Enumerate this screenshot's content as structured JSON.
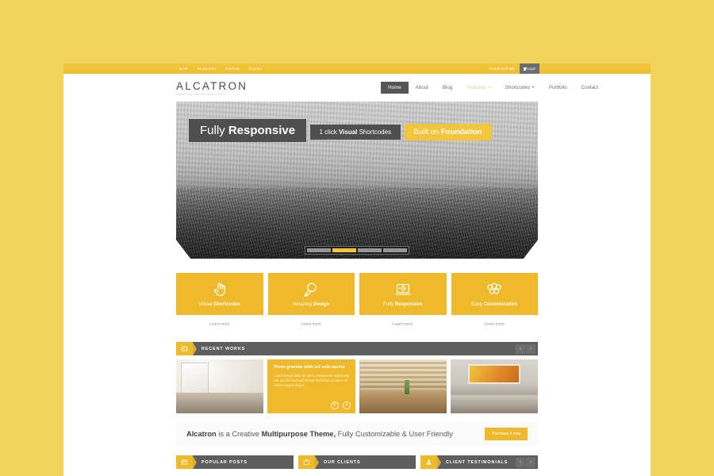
{
  "theme": {
    "bg_color": "#f2d35c",
    "accent_color": "#eeba2c",
    "dark_color": "#5e5e5e"
  },
  "topbar": {
    "links": [
      "Book",
      "Restaurant",
      "Sitemap",
      "Contact"
    ],
    "phone": "+44 658 5478 990",
    "login_label": "Login",
    "lock_icon": "lock-icon"
  },
  "header": {
    "logo_title": "ALCATRON",
    "logo_subtitle": "Amazing wordpress theme",
    "nav": [
      {
        "label": "Home",
        "active": true,
        "has_caret": false,
        "dim": false
      },
      {
        "label": "About",
        "active": false,
        "has_caret": false,
        "dim": false
      },
      {
        "label": "Blog",
        "active": false,
        "has_caret": false,
        "dim": false
      },
      {
        "label": "Features",
        "active": false,
        "has_caret": true,
        "dim": true
      },
      {
        "label": "Shortcodes",
        "active": false,
        "has_caret": true,
        "dim": false
      },
      {
        "label": "Portfolio",
        "active": false,
        "has_caret": false,
        "dim": false
      },
      {
        "label": "Contact",
        "active": false,
        "has_caret": false,
        "dim": false
      }
    ]
  },
  "hero": {
    "image_description": "Grayscale aerial cityscape with hazy sky",
    "caption_1_light": "Fully ",
    "caption_1_bold": "Responsive",
    "caption_2_pre": "1 click ",
    "caption_2_bold": "Visual",
    "caption_2_post": " Shortcodes",
    "caption_3_pre": "Built on ",
    "caption_3_bold": "Foundation",
    "prev_icon": "chevron-left-icon",
    "next_icon": "chevron-right-icon",
    "segments": 4,
    "active_segment": 2
  },
  "features": [
    {
      "label_light": "Visual ",
      "label_bold": "Shortcodes",
      "icon": "pointing-hand-icon",
      "more": "Learn more"
    },
    {
      "label_light": "Amazing ",
      "label_bold": "Design",
      "icon": "lightbulb-pencil-icon",
      "more": "Learn more"
    },
    {
      "label_light": "Fully ",
      "label_bold": "Responsive",
      "icon": "laptop-icon",
      "more": "Learn more"
    },
    {
      "label_light": "Easy ",
      "label_bold": "Customization",
      "icon": "gears-icon",
      "more": "Learn more"
    }
  ],
  "recent_works": {
    "title": "RECENT WORKS",
    "icon": "image-icon",
    "prev_icon": "chevron-left-icon",
    "next_icon": "chevron-right-icon",
    "items": [
      {
        "caption": "",
        "hovered": false,
        "photo": "bright-white-bedroom-interior"
      },
      {
        "caption": "Proin gravida nibh vel velit auctor",
        "body": "Lorem ipsum dolor sit amet, consectetur adipiscing elit, sed do eiusmod tempor incididunt ut labore et dolore magna aliqua.",
        "hovered": true,
        "zoom_icon": "magnifier-icon",
        "link_icon": "link-icon"
      },
      {
        "caption": "",
        "hovered": false,
        "photo": "wood-panel-lounge-chair-interior"
      },
      {
        "caption": "",
        "hovered": false,
        "photo": "bedroom-with-yellow-artwork"
      }
    ]
  },
  "promo": {
    "brand": "Alcatron",
    "mid": " is a Creative ",
    "bold2": "Multipurpose Theme,",
    "tail": " Fully Customizable & User Friendly",
    "button_label": "Purchase it now"
  },
  "bottom_sections": [
    {
      "title": "POPULAR POSTS",
      "icon": "article-icon",
      "has_nav": false
    },
    {
      "title": "OUR CLIENTS",
      "icon": "briefcase-icon",
      "has_nav": false
    },
    {
      "title": "CLIENT TESTIMONIALS",
      "icon": "user-icon",
      "has_nav": true,
      "prev_icon": "chevron-left-icon",
      "next_icon": "chevron-right-icon"
    }
  ]
}
